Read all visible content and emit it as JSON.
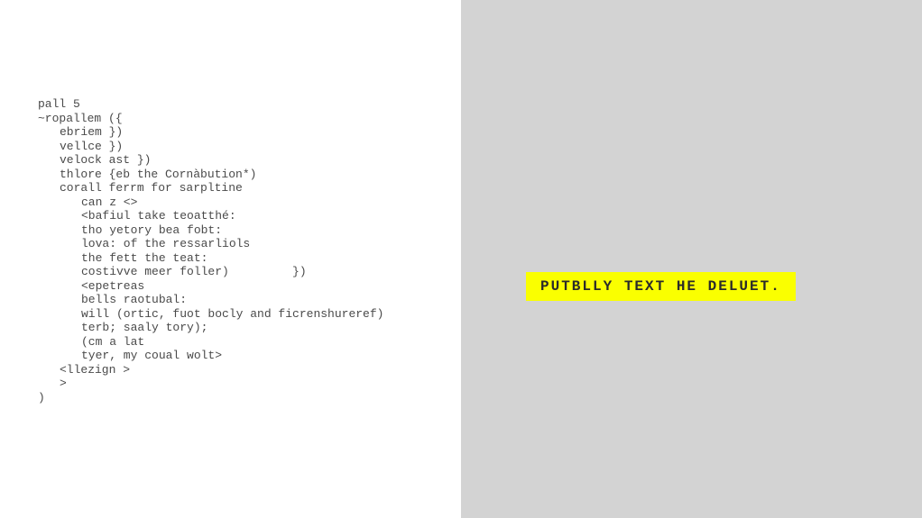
{
  "code": {
    "lines": [
      {
        "text": "pall 5",
        "indent": 0
      },
      {
        "text": "~ropallem ({",
        "indent": 0
      },
      {
        "text": "ebriem })",
        "indent": 1
      },
      {
        "text": "vellce })",
        "indent": 1
      },
      {
        "text": "velock ast })",
        "indent": 1
      },
      {
        "text": "thlore {eb the Cornàbution*)",
        "indent": 1
      },
      {
        "text": "corall ferrm for sarpltine",
        "indent": 1
      },
      {
        "text": "can z <>",
        "indent": 2
      },
      {
        "text": "<bafiul take teoatthé:",
        "indent": 2
      },
      {
        "text": "tho yetory bea fobt:",
        "indent": 2
      },
      {
        "text": "lova: of the ressarliols",
        "indent": 2
      },
      {
        "text": "the fett the teat:",
        "indent": 2
      },
      {
        "text": "costivve meer foller)         })",
        "indent": 2
      },
      {
        "text": "<epetreas",
        "indent": 2
      },
      {
        "text": "bells raotubal:",
        "indent": 2
      },
      {
        "text": "will (ortic, fuot bocly and ficrenshureref)",
        "indent": 2
      },
      {
        "text": "terb; saaly tory);",
        "indent": 2
      },
      {
        "text": "(cm a lat",
        "indent": 2
      },
      {
        "text": "tyer, my coual wolt>",
        "indent": 2
      },
      {
        "text": "<llezign >",
        "indent": 1
      },
      {
        "text": ">",
        "indent": 1
      },
      {
        "text": ")",
        "indent": 0
      }
    ]
  },
  "highlight": {
    "text": "PUTBLLY TEXT HE DELUET."
  }
}
